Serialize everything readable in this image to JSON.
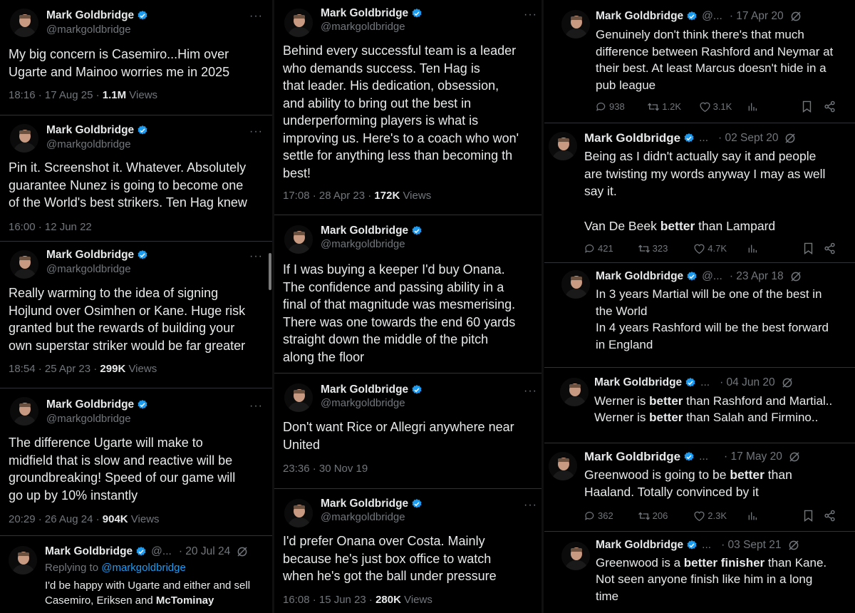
{
  "author": {
    "name": "Mark Goldbridge",
    "handle": "@markgoldbridge",
    "handle_short": "@..."
  },
  "col1": [
    {
      "text": "My big concern is Casemiro...Him over\nUgarte and Mainoo worries me in 2025",
      "time": "18:16 · 17 Aug 25 · ",
      "views": "1.1M",
      "views_label": " Views"
    },
    {
      "text": "Pin it. Screenshot it. Whatever. Absolutely\nguarantee Nunez is going to become one\nof the World's best strikers. Ten Hag knew",
      "time": "16:00 · 12 Jun 22"
    },
    {
      "text": "Really warming to the idea of signing\nHojlund over Osimhen or Kane. Huge risk\ngranted but the rewards of building your\nown superstar striker would be far greater",
      "time": "18:54 · 25 Apr 23 · ",
      "views": "299K",
      "views_label": " Views"
    },
    {
      "text": "The difference Ugarte will make to\nmidfield that is slow and reactive will be\ngroundbreaking! Speed of our game will\ngo up by 10% instantly",
      "time": "20:29 · 26 Aug 24 · ",
      "views": "904K",
      "views_label": " Views"
    },
    {
      "date": "· 20 Jul 24",
      "replying_prefix": "Replying to ",
      "replying_handle": "@markgoldbridge",
      "text_a": "I'd be happy with Ugarte and either and sell\nCasemiro, Eriksen and ",
      "text_b": "McTominay"
    }
  ],
  "col2": [
    {
      "text": "Behind every successful team is a leader\nwho demands success. Ten Hag is\nthat leader. His dedication, obsession,\nand ability to bring out the best in\nunderperforming players is what is\nimproving us. Here's to a coach who won'\nsettle for anything less than becoming th\nbest!",
      "time": "17:08 · 28 Apr 23 · ",
      "views": "172K",
      "views_label": " Views"
    },
    {
      "text": "If I was buying a keeper I'd buy Onana.\nThe confidence and passing ability in a\nfinal of that magnitude was mesmerising.\nThere was one towards the end 60 yards\nstraight down the middle of the pitch\nalong the floor"
    },
    {
      "text": "Don't want Rice or Allegri anywhere near\nUnited",
      "time": "23:36 · 30 Nov 19"
    },
    {
      "text": "I'd prefer Onana over Costa. Mainly\nbecause he's just box office to watch\nwhen he's got the ball under pressure",
      "time": "16:08 · 15 Jun 23 · ",
      "views": "280K",
      "views_label": " Views"
    }
  ],
  "col3": [
    {
      "handle": "@...",
      "date": "· 17 Apr 20",
      "text": "Genuinely don't think there's that much\ndifference between Rashford and Neymar at\ntheir best. At least Marcus doesn't hide in a\npub league",
      "replies": "938",
      "retweets": "1.2K",
      "likes": "3.1K"
    },
    {
      "handle": "...",
      "date": "· 02 Sept 20",
      "text": "Being as I didn't actually say it and people\nare twisting my words anyway I may as well\nsay it.",
      "text2_a": "Van De Beek ",
      "text2_b": "better",
      "text2_c": " than Lampard",
      "replies": "421",
      "retweets": "323",
      "likes": "4.7K"
    },
    {
      "handle": "@...",
      "date": "· 23 Apr 18",
      "text": "In 3 years Martial will be one of the best in\nthe World\nIn 4 years Rashford will be the best forward\nin England"
    },
    {
      "handle": "...",
      "date": "· 04 Jun 20",
      "l1a": "Werner is ",
      "l1b": "better",
      "l1c": " than Rashford and Martial..",
      "l2a": "Werner is ",
      "l2b": "better",
      "l2c": " than Salah and Firmino.."
    },
    {
      "handle": "...",
      "date": "· 17 May 20",
      "l1a": "Greenwood is going to be ",
      "l1b": "better",
      "l1c": " than",
      "l2": "Haaland. Totally convinced by it",
      "replies": "362",
      "retweets": "206",
      "likes": "2.3K"
    },
    {
      "handle": "...",
      "date": "· 03 Sept 21",
      "l1a": "Greenwood is a ",
      "l1b": "better finisher",
      "l1c": " than Kane.",
      "l2": "Not seen anyone finish like him in a long\ntime"
    }
  ],
  "more_label": "···",
  "colors": {
    "bg": "#000000",
    "text": "#e7e9ea",
    "muted": "#71767b",
    "link": "#1d9bf0",
    "verified": "#1d9bf0",
    "divider": "#2f3336"
  }
}
